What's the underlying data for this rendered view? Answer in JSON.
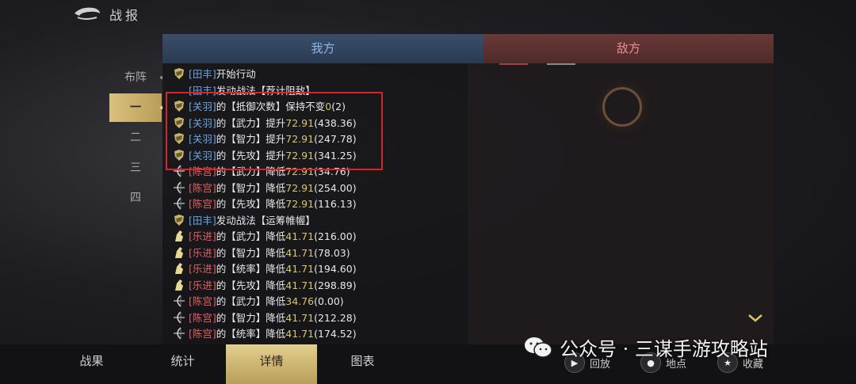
{
  "header": {
    "title": "战报"
  },
  "sidenav": {
    "items": [
      {
        "label": "布阵"
      },
      {
        "label": "一"
      },
      {
        "label": "二"
      },
      {
        "label": "三"
      },
      {
        "label": "四"
      }
    ],
    "active_index": 1
  },
  "tabs": {
    "my_side": "我方",
    "enemy_side": "敌方"
  },
  "log": [
    {
      "icon": "shield",
      "name": "田丰",
      "name_color": "blue",
      "text": "开始行动"
    },
    {
      "icon": "none",
      "name": "田丰",
      "name_color": "blue",
      "text": "发动战法【荐计阻敌】"
    },
    {
      "icon": "shield",
      "name": "关羽",
      "name_color": "blue",
      "pre": "的【抵御次数】保持不变",
      "num": "0",
      "post": "(2)"
    },
    {
      "icon": "shield",
      "name": "关羽",
      "name_color": "blue",
      "pre": "的【武力】提升",
      "num": "72.91",
      "post": "(438.36)"
    },
    {
      "icon": "shield",
      "name": "关羽",
      "name_color": "blue",
      "pre": "的【智力】提升",
      "num": "72.91",
      "post": "(247.78)"
    },
    {
      "icon": "shield",
      "name": "关羽",
      "name_color": "blue",
      "pre": "的【先攻】提升",
      "num": "72.91",
      "post": "(341.25)"
    },
    {
      "icon": "bow",
      "name": "陈宫",
      "name_color": "red",
      "pre": "的【武力】降低",
      "num": "72.91",
      "post": "(34.76)"
    },
    {
      "icon": "bow",
      "name": "陈宫",
      "name_color": "red",
      "pre": "的【智力】降低",
      "num": "72.91",
      "post": "(254.00)"
    },
    {
      "icon": "bow",
      "name": "陈宫",
      "name_color": "red",
      "pre": "的【先攻】降低",
      "num": "72.91",
      "post": "(116.13)"
    },
    {
      "icon": "shield",
      "name": "田丰",
      "name_color": "blue",
      "text": "发动战法【运筹帷幄】"
    },
    {
      "icon": "horse",
      "name": "乐进",
      "name_color": "red",
      "pre": "的【武力】降低",
      "num": "41.71",
      "post": "(216.00)"
    },
    {
      "icon": "horse",
      "name": "乐进",
      "name_color": "red",
      "pre": "的【智力】降低",
      "num": "41.71",
      "post": "(78.03)"
    },
    {
      "icon": "horse",
      "name": "乐进",
      "name_color": "red",
      "pre": "的【统率】降低",
      "num": "41.71",
      "post": "(194.60)"
    },
    {
      "icon": "horse",
      "name": "乐进",
      "name_color": "red",
      "pre": "的【先攻】降低",
      "num": "41.71",
      "post": "(298.89)"
    },
    {
      "icon": "bow",
      "name": "陈宫",
      "name_color": "red",
      "pre": "的【武力】降低",
      "num": "34.76",
      "post": "(0.00)"
    },
    {
      "icon": "bow",
      "name": "陈宫",
      "name_color": "red",
      "pre": "的【智力】降低",
      "num": "41.71",
      "post": "(212.28)"
    },
    {
      "icon": "bow",
      "name": "陈宫",
      "name_color": "red",
      "pre": "的【统率】降低",
      "num": "41.71",
      "post": "(174.52)"
    }
  ],
  "bottom_tabs": [
    {
      "label": "战果"
    },
    {
      "label": "统计"
    },
    {
      "label": "详情"
    },
    {
      "label": "图表"
    }
  ],
  "bottom_active_index": 2,
  "actions": {
    "replay": "回放",
    "location": "地点",
    "favorite": "收藏"
  },
  "watermark": {
    "text": "公众号 · 三谋手游攻略站"
  },
  "colors": {
    "name_blue": "#6aa6e4",
    "name_red": "#e06060",
    "number": "#d8c66a",
    "gold": "#d9c27e",
    "highlight": "#d62626"
  }
}
